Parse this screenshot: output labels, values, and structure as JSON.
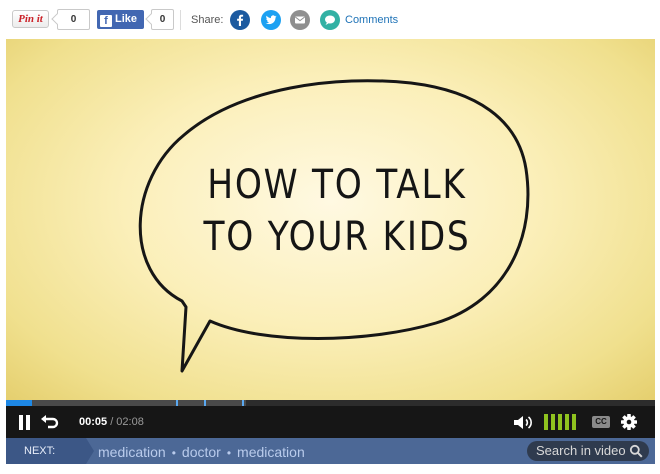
{
  "share_bar": {
    "pin_label": "Pin it",
    "pin_count": "0",
    "fb_label": "Like",
    "fb_icon_glyph": "f",
    "fb_count": "0",
    "share_label": "Share:",
    "share_icons": [
      "facebook-icon",
      "twitter-icon",
      "email-icon",
      "comments-icon"
    ],
    "comments_label": "Comments"
  },
  "video": {
    "title_line1": "HOW TO TALK",
    "title_line2": "TO YOUR KIDS",
    "progress_fraction": 0.04
  },
  "controls": {
    "current_time": "00:05",
    "duration": " / 02:08",
    "volume_level_bars": 5,
    "cc_label": "CC"
  },
  "next_bar": {
    "label": "NEXT:",
    "tags": [
      "medication",
      "doctor",
      "medication"
    ],
    "search_label": "Search in video"
  },
  "colors": {
    "facebook": "#1c5aa0",
    "twitter": "#1da1f2",
    "email": "#8f8f8f",
    "comments": "#32b1a4",
    "progress": "#1e88e5",
    "volume": "#8fc31f",
    "next_bar": "#4c6896"
  }
}
